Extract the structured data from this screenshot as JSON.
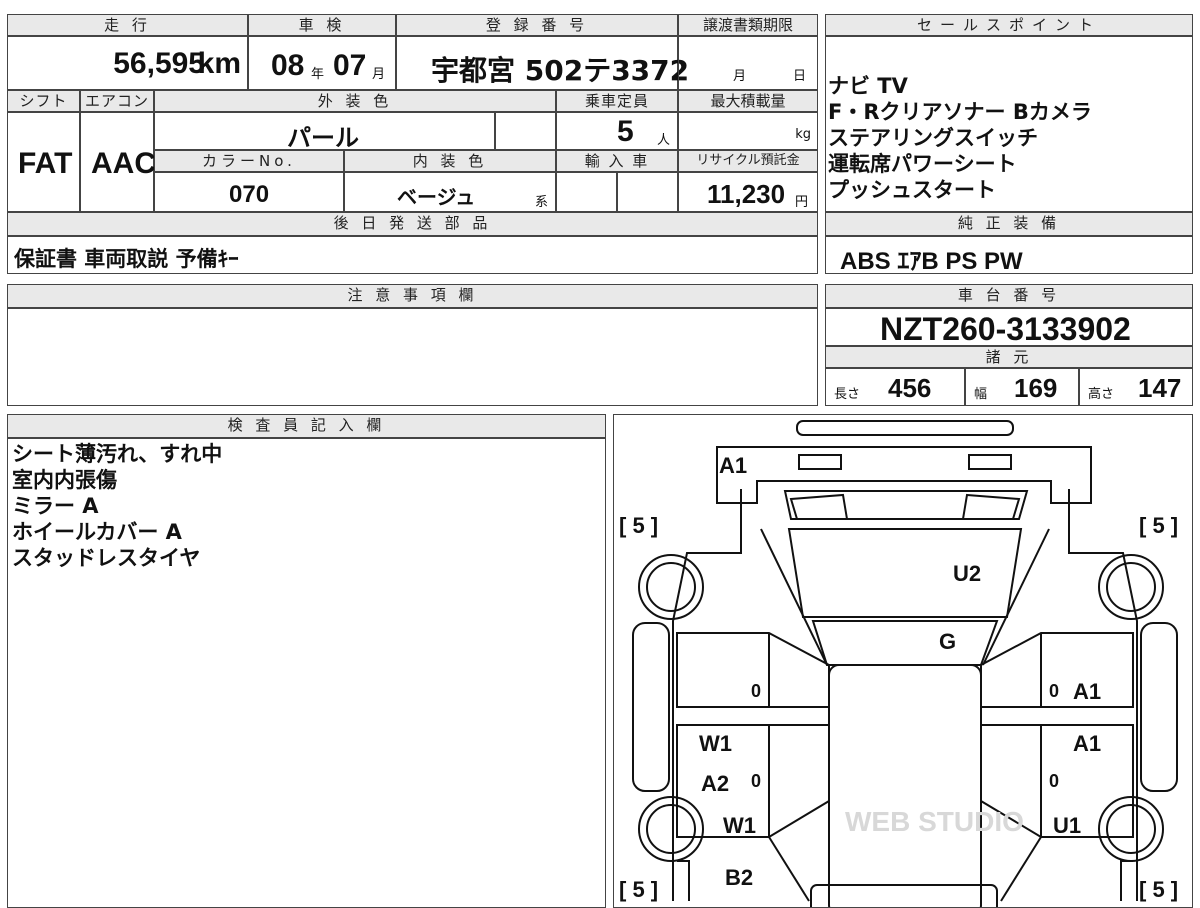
{
  "headers": {
    "mileage": "走 行",
    "inspection": "車 検",
    "registration": "登 録 番 号",
    "transfer_deadline": "譲渡書類期限",
    "sales_points": "セールスポイント",
    "shift": "シフト",
    "aircon": "エアコン",
    "exterior_color": "外 装 色",
    "capacity": "乗車定員",
    "max_load": "最大積載量",
    "color_no": "カラーNo.",
    "interior_color": "内 装 色",
    "import": "輸 入 車",
    "recycle_fee": "リサイクル預託金",
    "later_shipment": "後 日 発 送 部 品",
    "genuine_equipment": "純 正 装 備",
    "notes": "注 意 事 項 欄",
    "chassis_number": "車 台 番 号",
    "specs": "諸 元",
    "inspector": "検 査 員 記 入 欄"
  },
  "values": {
    "mileage": "56,595",
    "mileage_unit": "km",
    "inspection_year": "08",
    "year_unit": "年",
    "inspection_month": "07",
    "month_unit": "月",
    "registration": "宇都宮 502テ3372",
    "deadline_month_label": "月",
    "deadline_day_label": "日",
    "shift": "FAT",
    "aircon": "AAC",
    "exterior_color": "パール",
    "capacity": "5",
    "capacity_unit": "人",
    "max_load_unit": "kg",
    "color_no": "070",
    "interior_color": "ベージュ",
    "interior_suffix": "系",
    "recycle_fee": "11,230",
    "recycle_unit": "円",
    "later_shipment": "保証書 車両取説 予備ｷｰ",
    "genuine_equipment": "ABS ｴｱB PS PW",
    "chassis_number": "NZT260-3133902",
    "length_label": "長さ",
    "length": "456",
    "width_label": "幅",
    "width": "169",
    "height_label": "高さ",
    "height": "147"
  },
  "sales_points": [
    "ナビ TV",
    "F・Rクリアソナー Bカメラ",
    "ステアリングスイッチ",
    "運転席パワーシート",
    "プッシュスタート"
  ],
  "inspector_notes": [
    "シート薄汚れ、すれ中",
    "室内内張傷",
    "ミラー A",
    "ホイールカバー A",
    "スタッドレスタイヤ"
  ],
  "diagram": {
    "tire_left_front": "[ 5 ]",
    "tire_right_front": "[ 5 ]",
    "tire_left_rear": "[ 5 ]",
    "tire_right_rear": "[ 5 ]",
    "front_bumper": "A1",
    "hood": "U2",
    "windshield": "G",
    "left_front_door_zero": "0",
    "right_front_door_zero": "0",
    "right_front_door": "A1",
    "right_rear_door": "A1",
    "left_rear_door_w": "W1",
    "left_rear_door_a": "A2",
    "left_rear_door_zero": "0",
    "right_rear_door_zero": "0",
    "left_rear_fender": "W1",
    "right_rear_fender": "U1",
    "rear_bumper": "B2",
    "watermark": "WEB STUDIO"
  }
}
